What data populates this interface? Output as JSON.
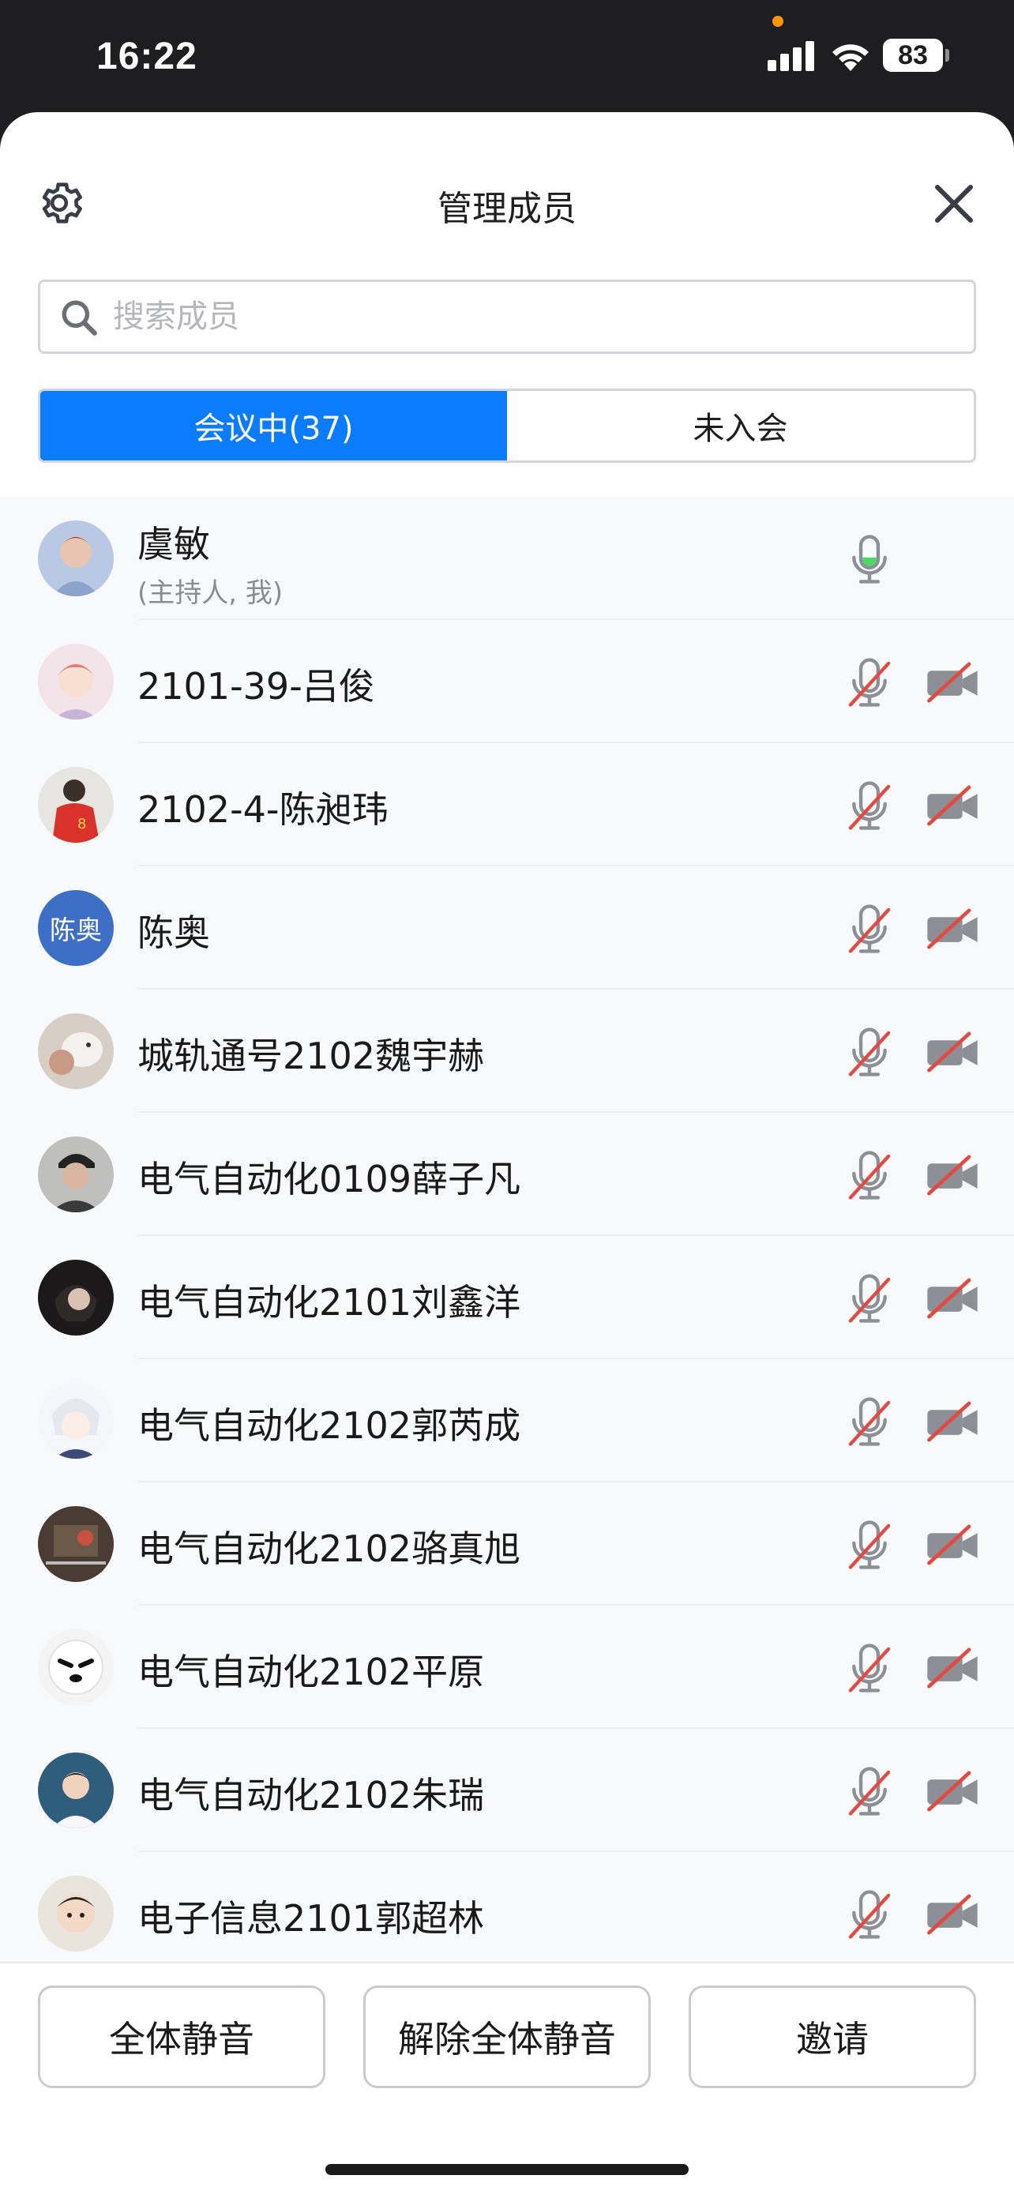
{
  "status_bar": {
    "time": "16:22",
    "battery": "83"
  },
  "header": {
    "title": "管理成员"
  },
  "search": {
    "placeholder": "搜索成员"
  },
  "tabs": [
    {
      "label": "会议中(37)",
      "active": true
    },
    {
      "label": "未入会",
      "active": false
    }
  ],
  "members": [
    {
      "name": "虞敏",
      "role": "(主持人, 我)",
      "avatar": "photo",
      "mic": "on",
      "camera": "hidden"
    },
    {
      "name": "2101-39-吕俊",
      "avatar": "photo",
      "mic": "muted",
      "camera": "off"
    },
    {
      "name": "2102-4-陈昶玮",
      "avatar": "photo",
      "mic": "muted",
      "camera": "off"
    },
    {
      "name": "陈奥",
      "avatar_text": "陈奥",
      "avatar": "text",
      "mic": "muted",
      "camera": "off"
    },
    {
      "name": "城轨通号2102魏宇赫",
      "avatar": "photo",
      "mic": "muted",
      "camera": "off"
    },
    {
      "name": "电气自动化0109薛子凡",
      "avatar": "photo",
      "mic": "muted",
      "camera": "off"
    },
    {
      "name": "电气自动化2101刘鑫洋",
      "avatar": "photo",
      "mic": "muted",
      "camera": "off"
    },
    {
      "name": "电气自动化2102郭芮成",
      "avatar": "photo",
      "mic": "muted",
      "camera": "off"
    },
    {
      "name": "电气自动化2102骆真旭",
      "avatar": "photo",
      "mic": "muted",
      "camera": "off"
    },
    {
      "name": "电气自动化2102平原",
      "avatar": "photo",
      "mic": "muted",
      "camera": "off"
    },
    {
      "name": "电气自动化2102朱瑞",
      "avatar": "photo",
      "mic": "muted",
      "camera": "off"
    },
    {
      "name": "电子信息2101郭超林",
      "avatar": "photo",
      "mic": "muted",
      "camera": "off"
    }
  ],
  "actions": {
    "mute_all": "全体静音",
    "unmute_all": "解除全体静音",
    "invite": "邀请"
  },
  "colors": {
    "accent": "#0a7cfd",
    "mic_active": "#4cd964",
    "muted_slash": "#e5483f"
  }
}
